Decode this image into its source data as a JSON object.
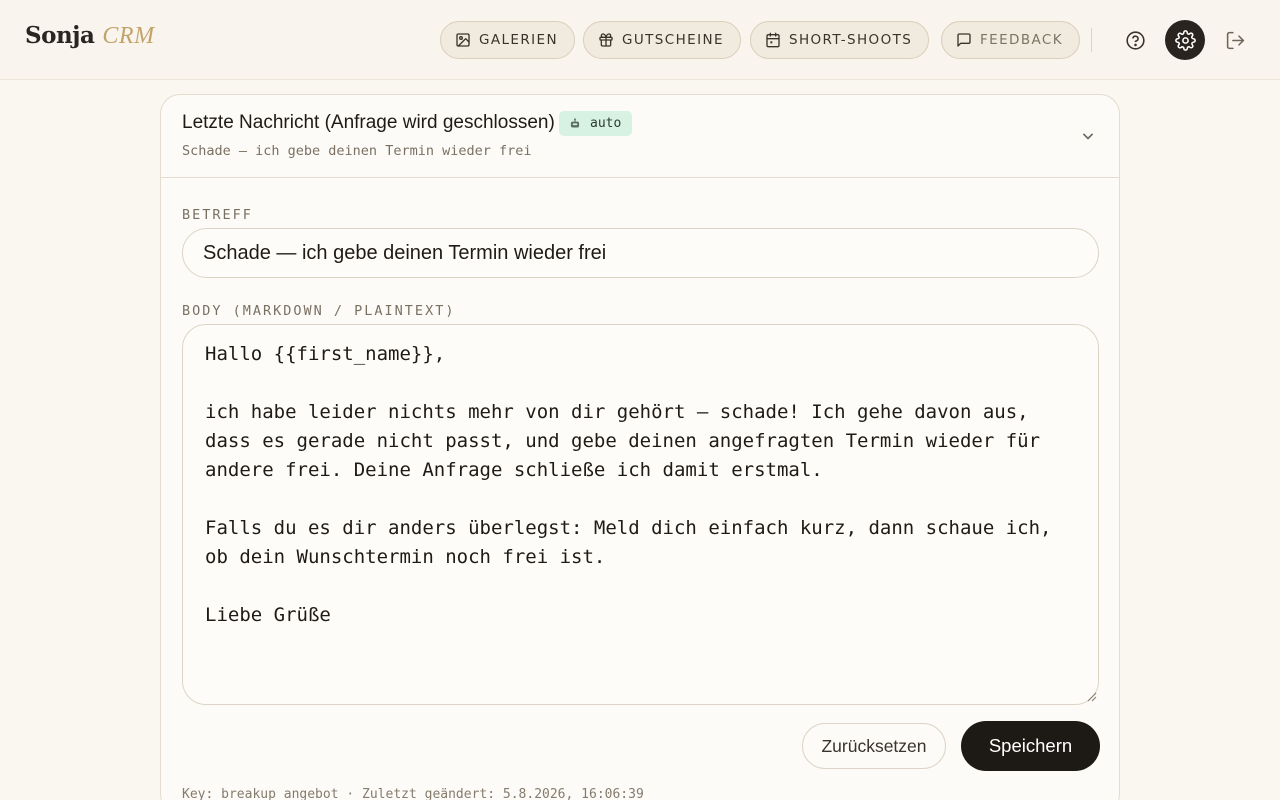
{
  "brand": {
    "name": "Sonja",
    "sub": "CRM"
  },
  "nav": {
    "galerien": "GALERIEN",
    "gutscheine": "GUTSCHEINE",
    "short_shoots": "SHORT-SHOOTS",
    "feedback": "FEEDBACK"
  },
  "header_icons": [
    "help-icon",
    "settings-icon",
    "logout-icon"
  ],
  "card": {
    "title": "Letzte Nachricht (Anfrage wird geschlossen)",
    "badge": "auto",
    "subtitle": "Schade — ich gebe deinen Termin wieder frei",
    "subject_label": "BETREFF",
    "subject_value": "Schade — ich gebe deinen Termin wieder frei",
    "body_label": "BODY (MARKDOWN / PLAINTEXT)",
    "body_value": "Hallo {{first_name}},\n\nich habe leider nichts mehr von dir gehört — schade! Ich gehe davon aus, dass es gerade nicht passt, und gebe deinen angefragten Termin wieder für andere frei. Deine Anfrage schließe ich damit erstmal.\n\nFalls du es dir anders überlegst: Meld dich einfach kurz, dann schaue ich, ob dein Wunschtermin noch frei ist.\n\nLiebe Grüße",
    "reset_label": "Zurücksetzen",
    "save_label": "Speichern",
    "meta": "Key: breakup_angebot · Zuletzt geändert: 5.8.2026, 16:06:39"
  },
  "colors": {
    "background": "#faf7f1",
    "accent": "#c2a46a",
    "badge_bg": "#d7f1e2",
    "primary_button": "#1d1915"
  }
}
